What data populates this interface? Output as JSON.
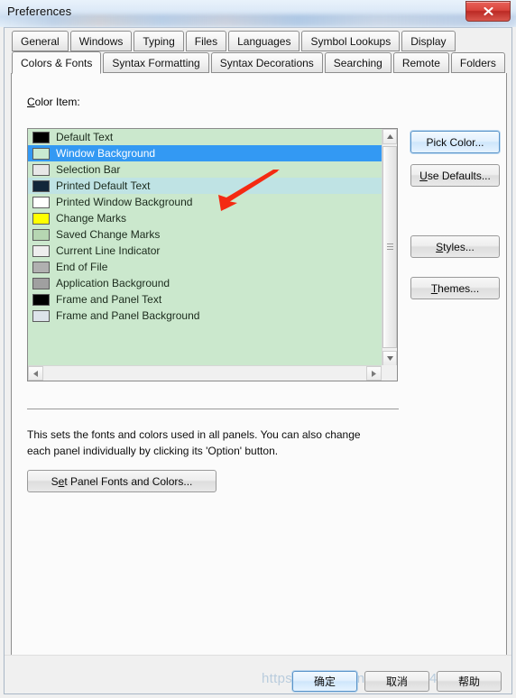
{
  "window": {
    "title": "Preferences",
    "close_icon": "close-x-icon"
  },
  "tabs": {
    "row1": [
      {
        "label": "General",
        "selected": false
      },
      {
        "label": "Windows",
        "selected": false
      },
      {
        "label": "Typing",
        "selected": false
      },
      {
        "label": "Files",
        "selected": false
      },
      {
        "label": "Languages",
        "selected": false
      },
      {
        "label": "Symbol Lookups",
        "selected": false
      },
      {
        "label": "Display",
        "selected": false
      }
    ],
    "row2": [
      {
        "label": "Colors & Fonts",
        "selected": true
      },
      {
        "label": "Syntax Formatting",
        "selected": false
      },
      {
        "label": "Syntax Decorations",
        "selected": false
      },
      {
        "label": "Searching",
        "selected": false
      },
      {
        "label": "Remote",
        "selected": false
      },
      {
        "label": "Folders",
        "selected": false
      }
    ]
  },
  "color_item": {
    "label_mnemonic": "C",
    "label_rest": "olor Item:",
    "list_background": "#cbe8cd",
    "selection_color": "#3399f3",
    "hover_color": "#bfe3e4",
    "items": [
      {
        "label": "Default Text",
        "swatch": "#000000",
        "state": "normal"
      },
      {
        "label": "Window Background",
        "swatch": "#c9ead1",
        "state": "selected"
      },
      {
        "label": "Selection Bar",
        "swatch": "#e7e7e7",
        "state": "normal"
      },
      {
        "label": "Printed Default Text",
        "swatch": "#12263a",
        "state": "hover"
      },
      {
        "label": "Printed Window Background",
        "swatch": "#ffffff",
        "state": "normal"
      },
      {
        "label": "Change Marks",
        "swatch": "#ffff00",
        "state": "normal"
      },
      {
        "label": "Saved Change Marks",
        "swatch": "#b6d6b2",
        "state": "normal"
      },
      {
        "label": "Current Line Indicator",
        "swatch": "#eeeeee",
        "state": "normal"
      },
      {
        "label": "End of File",
        "swatch": "#b0b0b0",
        "state": "normal"
      },
      {
        "label": "Application Background",
        "swatch": "#a0a0a0",
        "state": "normal"
      },
      {
        "label": "Frame and Panel Text",
        "swatch": "#000000",
        "state": "normal"
      },
      {
        "label": "Frame and Panel Background",
        "swatch": "#dde3ea",
        "state": "normal"
      }
    ]
  },
  "scrollbars": {
    "v_up_icon": "triangle-up-icon",
    "v_down_icon": "triangle-down-icon",
    "h_left_icon": "triangle-left-icon",
    "h_right_icon": "triangle-right-icon"
  },
  "annotation": {
    "arrow_color": "#f42a12",
    "name": "red-pointer-arrow"
  },
  "side_buttons": [
    {
      "id": "pick-color",
      "mnemonic": "",
      "pre": "Pick Color...",
      "post": "",
      "default": true
    },
    {
      "id": "use-defaults",
      "mnemonic": "U",
      "pre": "",
      "post": "se Defaults...",
      "default": false
    },
    {
      "id": "styles",
      "mnemonic": "S",
      "pre": "",
      "post": "tyles...",
      "default": false
    },
    {
      "id": "themes",
      "mnemonic": "T",
      "pre": "",
      "post": "hemes...",
      "default": false
    }
  ],
  "help": {
    "line1": "This sets the fonts and colors used in all panels. You can also change",
    "line2": "each panel individually by clicking its 'Option' button.",
    "set_panel_button": {
      "pre": "S",
      "mnemonic": "e",
      "post": "t Panel Fonts and Colors..."
    }
  },
  "bottom_buttons": [
    {
      "id": "ok",
      "label": "确定",
      "default": true
    },
    {
      "id": "cancel",
      "label": "取消",
      "default": false
    },
    {
      "id": "help",
      "label": "帮助",
      "default": false
    }
  ],
  "watermark": {
    "text": "https://blog.csdn.net/ixin_44        542"
  }
}
